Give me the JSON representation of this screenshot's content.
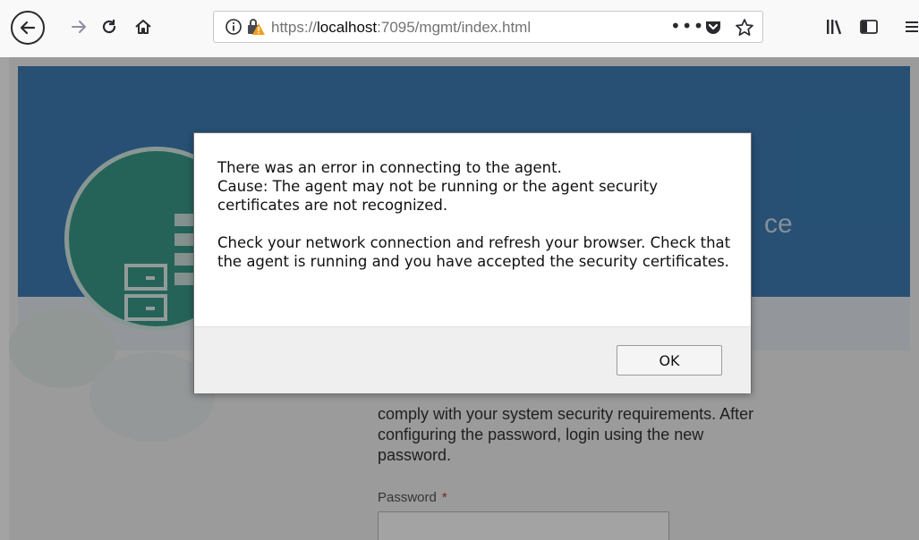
{
  "browser": {
    "url_prefix": "https://",
    "url_host": "localhost",
    "url_rest": ":7095/mgmt/index.html",
    "icons": {
      "back": "back-arrow-icon",
      "forward": "forward-arrow-icon",
      "reload": "reload-icon",
      "home": "home-icon",
      "page_actions": "more-dots-icon",
      "pocket": "pocket-icon",
      "bookmark": "star-icon",
      "library": "library-icon",
      "sidebar": "sidebar-icon",
      "menu": "hamburger-menu-icon"
    }
  },
  "page": {
    "hero_title_fragment": "ce",
    "instructions": "comply with your system security requirements. After configuring the password, login using the new password.",
    "password_label": "Password",
    "required_marker": "*"
  },
  "dialog": {
    "line1": "There was an error in connecting to the agent.",
    "line2": "Cause: The agent may not be running or the agent security certificates are not recognized.",
    "line3": "Check your network connection and refresh your browser. Check that the agent is running and you have accepted the security certificates.",
    "ok_label": "OK"
  },
  "colors": {
    "hero": "#3d7eb6",
    "logo": "#3a9c8c",
    "overlay": "rgba(0,0,0,0.36)"
  }
}
